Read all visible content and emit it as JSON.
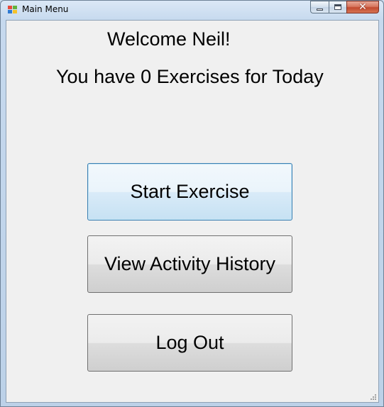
{
  "window": {
    "title": "Main Menu",
    "icon": "windows-form-icon",
    "controls": {
      "minimize": "minimize-icon",
      "maximize": "maximize-icon",
      "close_glyph": "✕"
    }
  },
  "main": {
    "welcome_text": "Welcome Neil!",
    "exercises_text": "You have 0 Exercises for Today",
    "buttons": {
      "start": "Start Exercise",
      "history": "View Activity History",
      "logout": "Log Out"
    }
  },
  "colors": {
    "client_background": "#f0f0f0",
    "focused_border": "#3c7fb1",
    "close_button": "#c24a2f"
  }
}
